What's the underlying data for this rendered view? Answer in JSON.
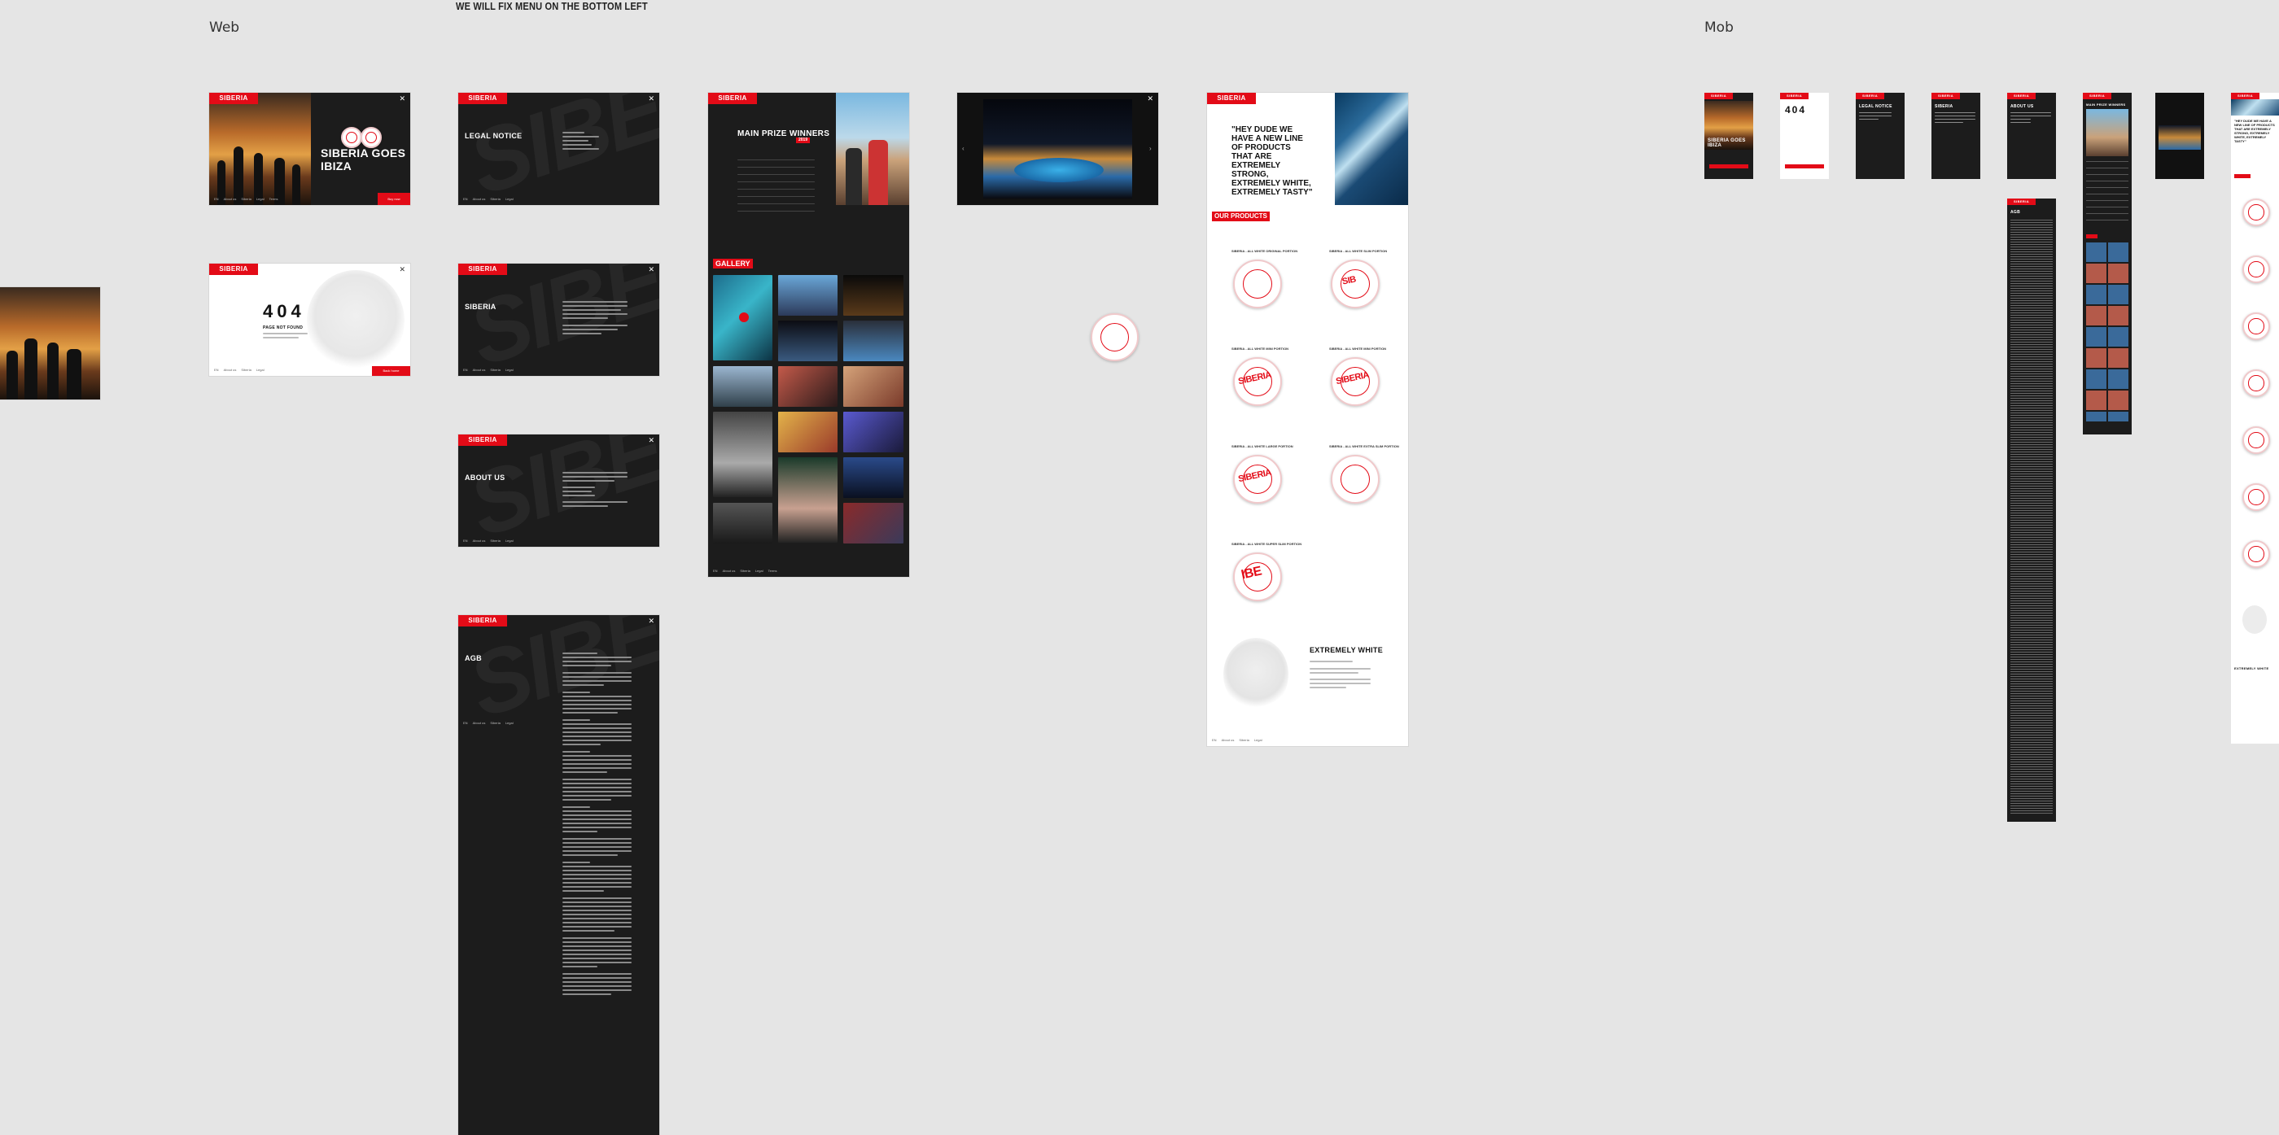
{
  "labels": {
    "web": "Web",
    "mob": "Mob",
    "note": "WE WILL FIX MENU ON THE BOTTOM LEFT"
  },
  "brand": {
    "logo": "SIBERIA",
    "accent": "#e30b17",
    "dark_bg": "#1c1c1c"
  },
  "footer_menu": [
    "EN",
    "About us",
    "Siberia",
    "Legal",
    "Terms",
    "Cookies"
  ],
  "frames": {
    "home": {
      "headline": "SIBERIA GOES IBIZA",
      "cta": "Buy now"
    },
    "notfound": {
      "code": "404",
      "title": "PAGE NOT FOUND",
      "cta": "Back home"
    },
    "legal": {
      "title": "LEGAL NOTICE"
    },
    "siberia": {
      "title": "SIBERIA"
    },
    "about": {
      "title": "ABOUT US"
    },
    "agb": {
      "title": "AGB"
    },
    "winners": {
      "title": "MAIN PRIZE WINNERS",
      "badge": "2019",
      "gallery": "GALLERY"
    },
    "products": {
      "quote": "\"HEY DUDE WE HAVE A NEW LINE OF PRODUCTS THAT ARE EXTREMELY STRONG, EXTREMELY WHITE, EXTREMELY TASTY\"",
      "section": "OUR PRODUCTS",
      "items": [
        "SIBERIA - ALL WHITE ORIGINAL PORTION",
        "SIBERIA - ALL WHITE SLIM PORTION",
        "SIBERIA - ALL WHITE MINI PORTION",
        "SIBERIA - ALL WHITE MINI PORTION",
        "SIBERIA - ALL WHITE LARGE PORTION",
        "SIBERIA - ALL WHITE EXTRA SLIM PORTION",
        "SIBERIA - ALL WHITE SUPER SLIM PORTION"
      ],
      "footer_title": "EXTREMELY WHITE"
    }
  },
  "mobile": {
    "home_headline": "SIBERIA GOES IBIZA",
    "notfound_code": "404",
    "legal_title": "LEGAL NOTICE",
    "siberia_title": "SIBERIA",
    "about_title": "ABOUT US",
    "agb_title": "AGB",
    "winners_title": "MAIN PRIZE WINNERS",
    "products_quote": "\"HEY DUDE WE HAVE A NEW LINE OF PRODUCTS THAT ARE EXTREMELY STRONG, EXTREMELY WHITE, EXTREMELY TASTY\"",
    "products_footer": "EXTREMELY WHITE"
  }
}
